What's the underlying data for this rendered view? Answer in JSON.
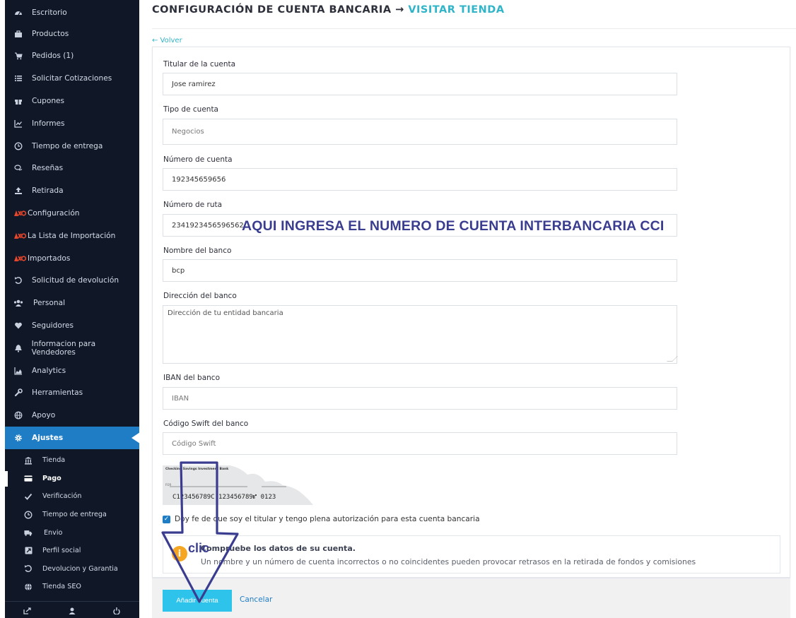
{
  "sidebar": {
    "items": [
      {
        "label": "Escritorio",
        "icon": "dashboard-icon"
      },
      {
        "label": "Productos",
        "icon": "briefcase-icon"
      },
      {
        "label": "Pedidos (1)",
        "icon": "cart-icon"
      },
      {
        "label": "Solicitar Cotizaciones",
        "icon": "list-icon"
      },
      {
        "label": "Cupones",
        "icon": "gift-icon"
      },
      {
        "label": "Informes",
        "icon": "line-chart-icon"
      },
      {
        "label": "Tiempo de entrega",
        "icon": "clock-icon"
      },
      {
        "label": "Reseñas",
        "icon": "comments-icon"
      },
      {
        "label": "Retirada",
        "icon": "upload-icon"
      },
      {
        "label": "Configuración",
        "icon": "ali-logo-icon"
      },
      {
        "label": "La Lista de Importación",
        "icon": "ali-logo-icon"
      },
      {
        "label": "Importados",
        "icon": "ali-logo-icon"
      },
      {
        "label": "Solicitud de devolución",
        "icon": "undo-icon"
      },
      {
        "label": "Personal",
        "icon": "users-icon"
      },
      {
        "label": "Seguidores",
        "icon": "heart-icon"
      },
      {
        "label": "Informacion para Vendedores",
        "icon": "bell-icon"
      },
      {
        "label": "Analytics",
        "icon": "area-chart-icon"
      },
      {
        "label": "Herramientas",
        "icon": "wrench-icon"
      },
      {
        "label": "Apoyo",
        "icon": "globe-icon"
      },
      {
        "label": "Ajustes",
        "icon": "gear-icon"
      }
    ],
    "sub_items": [
      {
        "label": "Tienda",
        "icon": "institution-icon"
      },
      {
        "label": "Pago",
        "icon": "credit-card-icon"
      },
      {
        "label": "Verificación",
        "icon": "check-icon"
      },
      {
        "label": "Tiempo de entrega",
        "icon": "clock-icon"
      },
      {
        "label": "Envio",
        "icon": "truck-icon"
      },
      {
        "label": "Perfil social",
        "icon": "share-square-icon"
      },
      {
        "label": "Devolucion y Garantia",
        "icon": "undo-icon"
      },
      {
        "label": "Tienda SEO",
        "icon": "globe-icon"
      }
    ]
  },
  "header": {
    "title": "CONFIGURACIÓN DE CUENTA BANCARIA →",
    "link": "VISITAR TIENDA"
  },
  "back_link": "← Volver",
  "form": {
    "holder_label": "Titular de la cuenta",
    "holder_value": "Jose ramirez",
    "type_label": "Tipo de cuenta",
    "type_value": "Negocios",
    "number_label": "Número de cuenta",
    "number_value": "192345659656",
    "routing_label": "Número de ruta",
    "routing_value": "2341923456596562",
    "bank_label": "Nombre del banco",
    "bank_value": "bcp",
    "address_label": "Dirección del banco",
    "address_placeholder": "Dirección de tu entidad bancaria",
    "iban_label": "IBAN del banco",
    "iban_placeholder": "IBAN",
    "swift_label": "Código Swift del banco",
    "swift_placeholder": "Código Swift"
  },
  "annotation": "AQUI INGRESA  EL NUMERO DE CUENTA INTERBANCARIA  CCI",
  "check_image": {
    "bank_name": "Checking Savings Investment Bank",
    "micr_line": "C123456789C 123456789⑈ 0123"
  },
  "consent_text": "Doy fe de que soy el titular y tengo plena autorización para esta cuenta bancaria",
  "notice": {
    "title": "Compruebe los datos de su cuenta.",
    "body": "Un nombre y un número de cuenta incorrectos o no coincidentes pueden provocar retrasos en la retirada de fondos y comisiones"
  },
  "clic_label": "clic",
  "add_button": "Añadir cuenta",
  "cancel_link": "Cancelar",
  "colors": {
    "sidebar_bg": "#101828",
    "active_bg": "#1f7dc6",
    "link": "#30b4c8",
    "button": "#2ec3ea",
    "annotation": "#3a3d8f"
  }
}
